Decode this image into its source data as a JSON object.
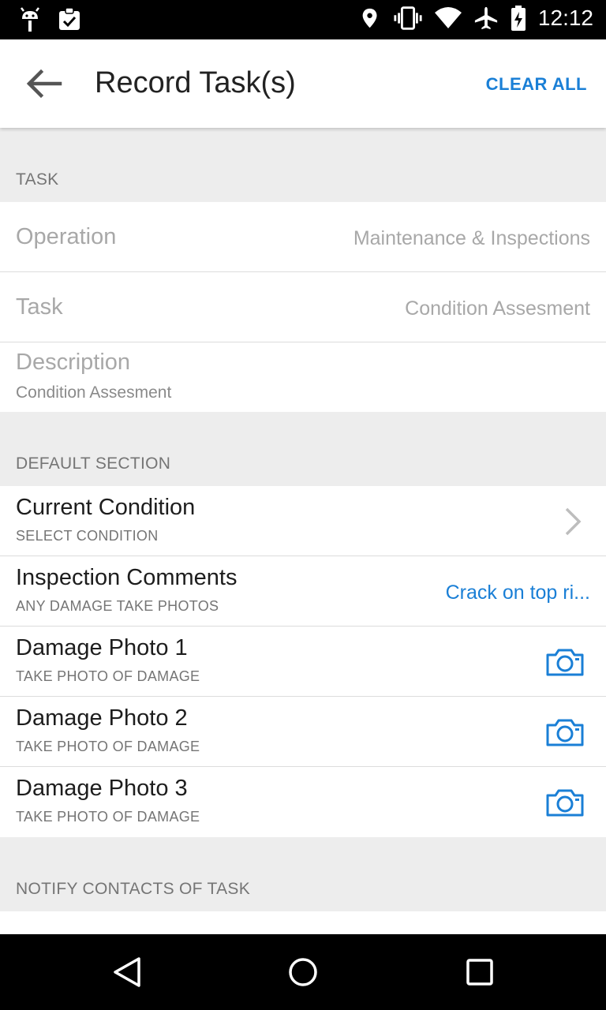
{
  "status_bar": {
    "time": "12:12",
    "left_icons": [
      "android-debug-icon",
      "clipboard-check-icon"
    ],
    "right_icons": [
      "location-pin-icon",
      "vibrate-icon",
      "wifi-icon",
      "airplane-icon",
      "battery-charging-icon"
    ]
  },
  "app_bar": {
    "title": "Record Task(s)",
    "action": "CLEAR ALL",
    "back_icon": "arrow-left-icon"
  },
  "task_section": {
    "header": "TASK",
    "operation_label": "Operation",
    "operation_value": "Maintenance & Inspections",
    "task_label": "Task",
    "task_value": "Condition Assesment",
    "description_label": "Description",
    "description_value": "Condition Assesment"
  },
  "default_section": {
    "header": "DEFAULT SECTION",
    "items": [
      {
        "title": "Current Condition",
        "subtitle": "SELECT CONDITION",
        "trailing": "chevron-right-icon"
      },
      {
        "title": "Inspection Comments",
        "subtitle": "ANY DAMAGE TAKE PHOTOS",
        "value": "Crack on top ri..."
      },
      {
        "title": "Damage Photo 1",
        "subtitle": "TAKE PHOTO OF DAMAGE",
        "trailing": "camera-icon"
      },
      {
        "title": "Damage Photo 2",
        "subtitle": "TAKE PHOTO OF DAMAGE",
        "trailing": "camera-icon"
      },
      {
        "title": "Damage Photo 3",
        "subtitle": "TAKE PHOTO OF DAMAGE",
        "trailing": "camera-icon"
      }
    ]
  },
  "notify_section": {
    "header": "NOTIFY CONTACTS OF TASK"
  },
  "nav_bar": {
    "buttons": [
      "back-triangle-icon",
      "home-circle-icon",
      "recents-square-icon"
    ]
  },
  "colors": {
    "accent": "#1a7fd6",
    "background": "#ededed",
    "surface": "#ffffff",
    "status_bar": "#000000"
  }
}
